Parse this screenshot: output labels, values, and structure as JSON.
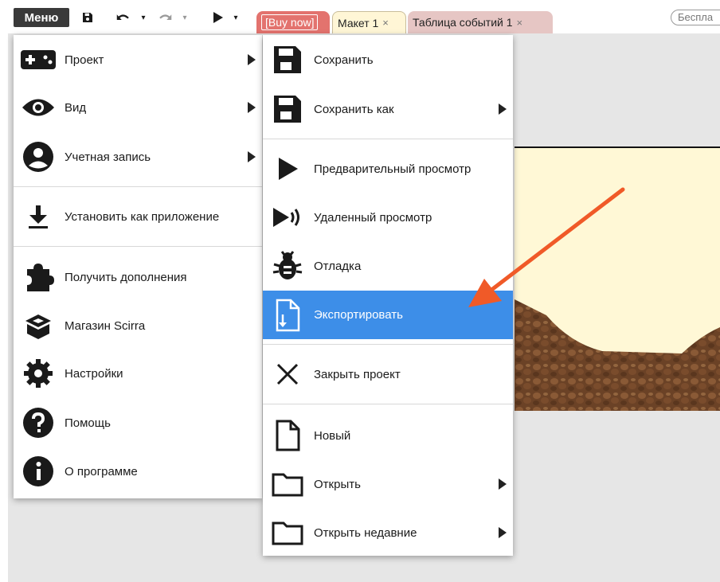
{
  "toolbar": {
    "menu_label": "Меню",
    "tabs": [
      {
        "label": "[Buy now]",
        "close": ""
      },
      {
        "label": "Макет 1",
        "close": "×"
      },
      {
        "label": "Таблица событий 1",
        "close": "×"
      }
    ],
    "badge": "Беспла"
  },
  "main_menu": {
    "items": [
      {
        "label": "Проект",
        "icon": "gamepad-icon",
        "submenu": true
      },
      {
        "label": "Вид",
        "icon": "eye-icon",
        "submenu": true
      },
      {
        "label": "Учетная запись",
        "icon": "account-icon",
        "submenu": true
      },
      {
        "label": "Установить как приложение",
        "icon": "download-icon"
      },
      {
        "label": "Получить дополнения",
        "icon": "puzzle-icon"
      },
      {
        "label": "Магазин Scirra",
        "icon": "store-box-icon"
      },
      {
        "label": "Настройки",
        "icon": "gear-icon"
      },
      {
        "label": "Помощь",
        "icon": "help-icon"
      },
      {
        "label": "О программе",
        "icon": "info-icon"
      }
    ]
  },
  "sub_menu": {
    "items": [
      {
        "label": "Сохранить",
        "icon": "save-icon"
      },
      {
        "label": "Сохранить как",
        "icon": "save-as-icon",
        "submenu": true
      },
      {
        "label": "Предварительный просмотр",
        "icon": "play-icon"
      },
      {
        "label": "Удаленный просмотр",
        "icon": "remote-preview-icon"
      },
      {
        "label": "Отладка",
        "icon": "bug-icon"
      },
      {
        "label": "Экспортировать",
        "icon": "export-icon",
        "highlighted": true
      },
      {
        "label": "Закрыть проект",
        "icon": "close-icon"
      },
      {
        "label": "Новый",
        "icon": "new-file-icon"
      },
      {
        "label": "Открыть",
        "icon": "folder-icon",
        "submenu": true
      },
      {
        "label": "Открыть недавние",
        "icon": "folder-recent-icon",
        "submenu": true
      }
    ]
  },
  "colors": {
    "highlight": "#3d8ee8",
    "annotation_arrow": "#f05a28",
    "canvas_bg": "#fff8d6",
    "dirt": "#6b4226"
  }
}
